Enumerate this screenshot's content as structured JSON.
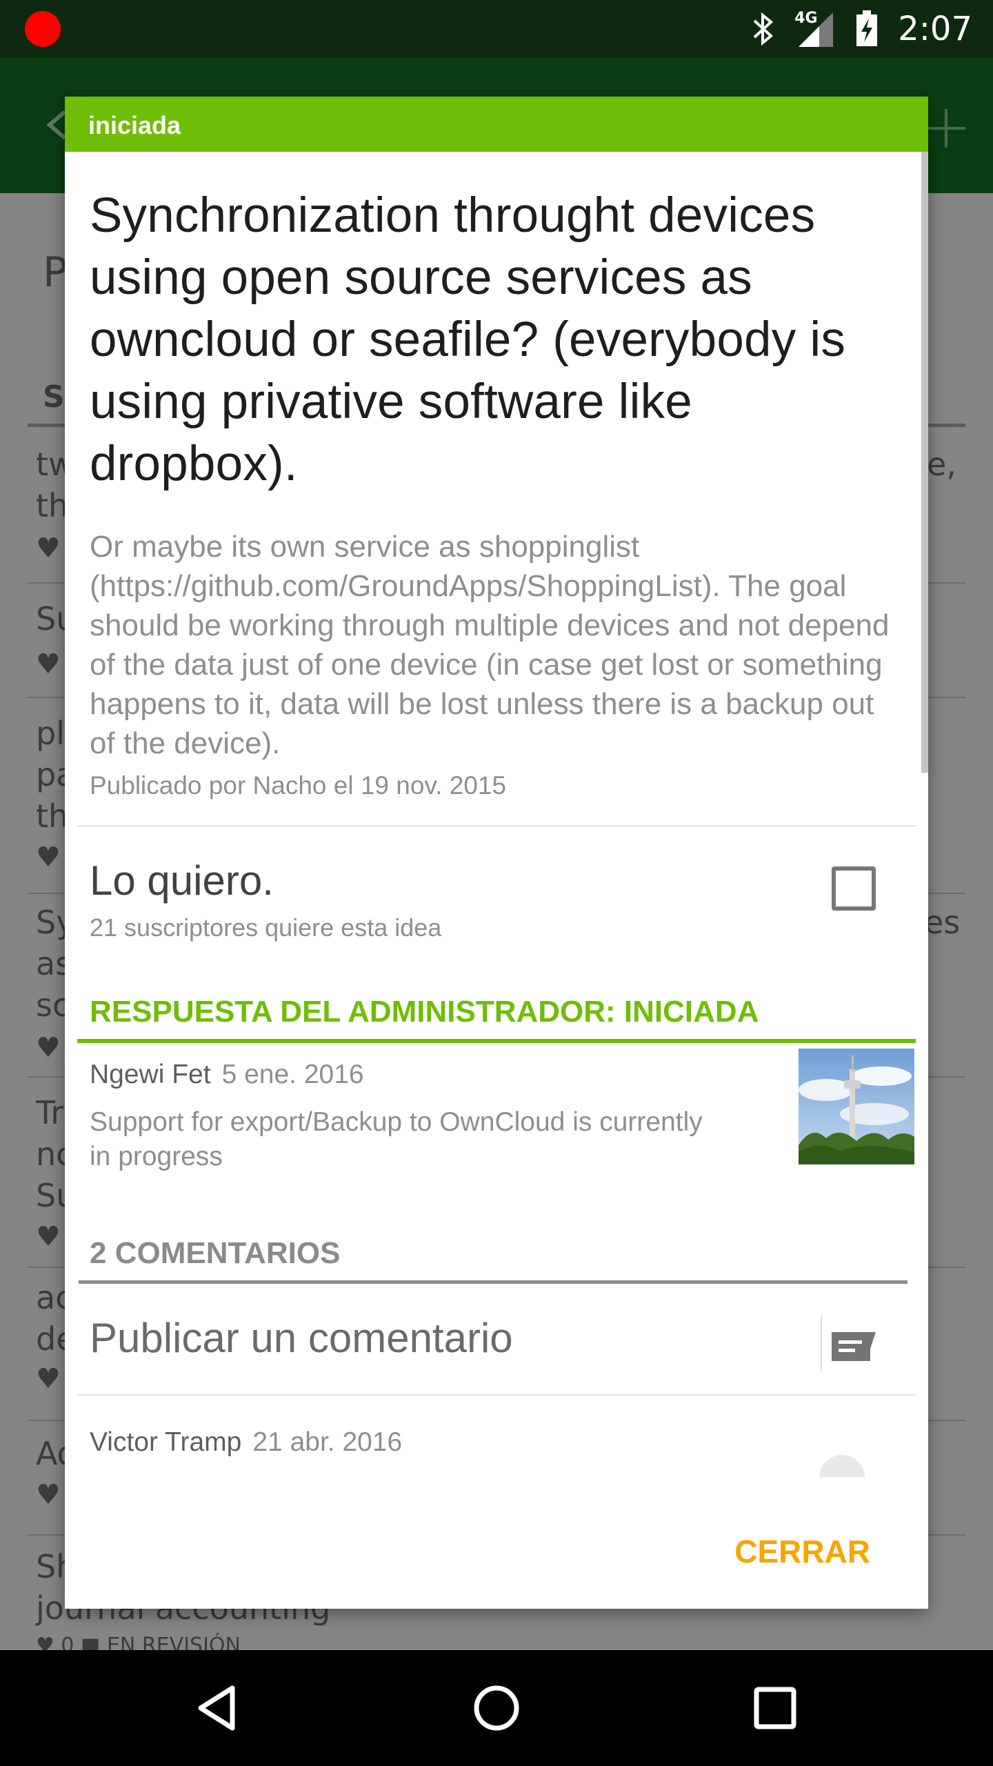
{
  "status_bar": {
    "time": "2:07",
    "network_label": "4G",
    "icons": [
      "recording-dot-icon",
      "bluetooth-icon",
      "signal-4g-icon",
      "battery-charging-icon"
    ]
  },
  "background": {
    "title_fragment": "P",
    "section_fragment": "S",
    "rows": [
      {
        "left": "tw",
        "left2": "th",
        "right": "e,"
      },
      {
        "left": "Su"
      },
      {
        "left": "pl",
        "left2": "pa",
        "left3": "th"
      },
      {
        "left": "Sy",
        "left2": "as",
        "left3": "sc",
        "right": "es"
      },
      {
        "left": "Tr",
        "left2": "nc",
        "left3": "Su"
      },
      {
        "left": "ac",
        "left2": "de"
      },
      {
        "left": "Ad"
      },
      {
        "left": "Sh",
        "left2": "journal accounting"
      }
    ],
    "bottom_fragment": "♥ 0   ■ EN REVISIÓN"
  },
  "dialog": {
    "status_label": "iniciada",
    "title": "Synchronization throught devices using open source services as owncloud or seafile? (everybody is using privative software like dropbox).",
    "description": "Or maybe its own service as shoppinglist (https://github.com/GroundApps/ShoppingList). The goal should be working through multiple devices and not depend of the data just of one device (in case get lost or something happens to it, data will be lost unless there is a backup out of the device).",
    "meta": "Publicado por Nacho el 19 nov. 2015",
    "vote": {
      "label": "Lo quiero.",
      "subscribers": "21 suscriptores quiere esta idea",
      "checked": false
    },
    "admin_response": {
      "heading": "RESPUESTA DEL ADMINISTRADOR: INICIADA",
      "author": "Ngewi Fet",
      "date": "5 ene. 2016",
      "text": "Support for export/Backup to OwnCloud is currently in progress"
    },
    "comments": {
      "heading": "2 COMENTARIOS",
      "input_placeholder": "Publicar un comentario",
      "items": [
        {
          "author": "Victor Tramp",
          "date": "21 abr. 2016"
        }
      ]
    },
    "close_label": "CERRAR"
  },
  "colors": {
    "accent_green": "#6fbd06",
    "close_orange": "#f5a600",
    "status_bar": "#0d2a10"
  }
}
